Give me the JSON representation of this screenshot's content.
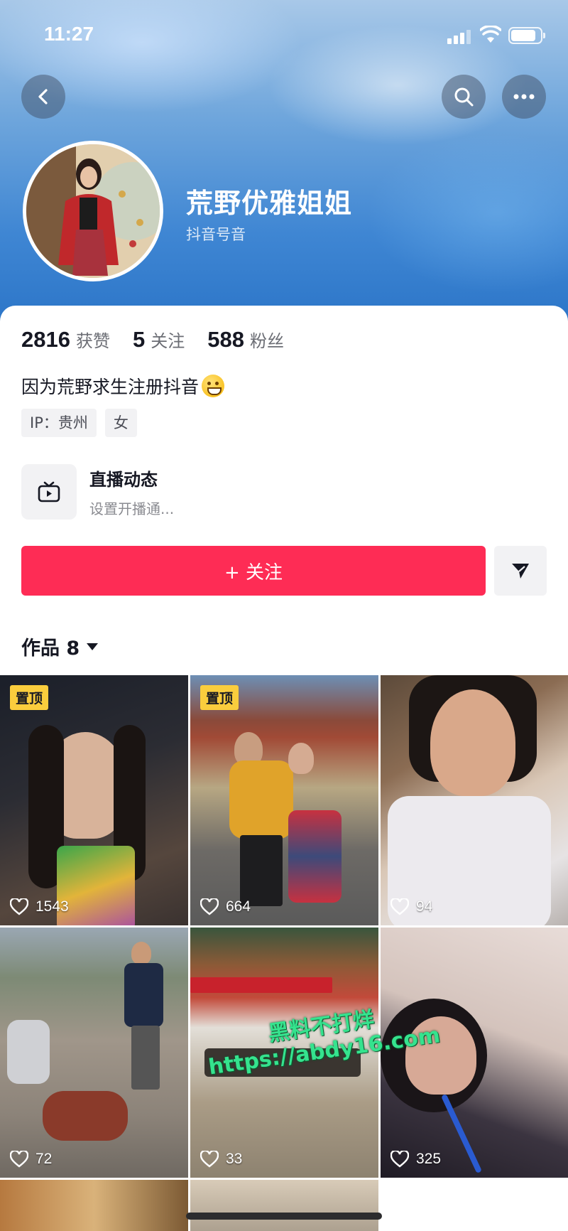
{
  "status_bar": {
    "time": "11:27"
  },
  "profile": {
    "display_name": "荒野优雅姐姐",
    "douyin_id": "抖音号音",
    "likes_count": "2816",
    "likes_label": "获赞",
    "following_count": "5",
    "following_label": "关注",
    "followers_count": "588",
    "followers_label": "粉丝",
    "bio": "因为荒野求生注册抖音",
    "tags": [
      "IP：贵州",
      "女"
    ]
  },
  "live": {
    "title": "直播动态",
    "subtitle": "设置开播通..."
  },
  "actions": {
    "follow_label": "+ 关注"
  },
  "works": {
    "label": "作品 8"
  },
  "pin_label": "置顶",
  "videos": [
    {
      "likes": "1543",
      "pinned": true
    },
    {
      "likes": "664",
      "pinned": true
    },
    {
      "likes": "94",
      "pinned": false
    },
    {
      "likes": "72",
      "pinned": false
    },
    {
      "likes": "33",
      "pinned": false
    },
    {
      "likes": "325",
      "pinned": false
    }
  ],
  "watermark": {
    "line1": "黑料不打烊",
    "line2": "https://abdy16.com"
  },
  "colors": {
    "accent": "#fe2c55",
    "pin": "#facd3d",
    "banner": "#3f86d3"
  }
}
